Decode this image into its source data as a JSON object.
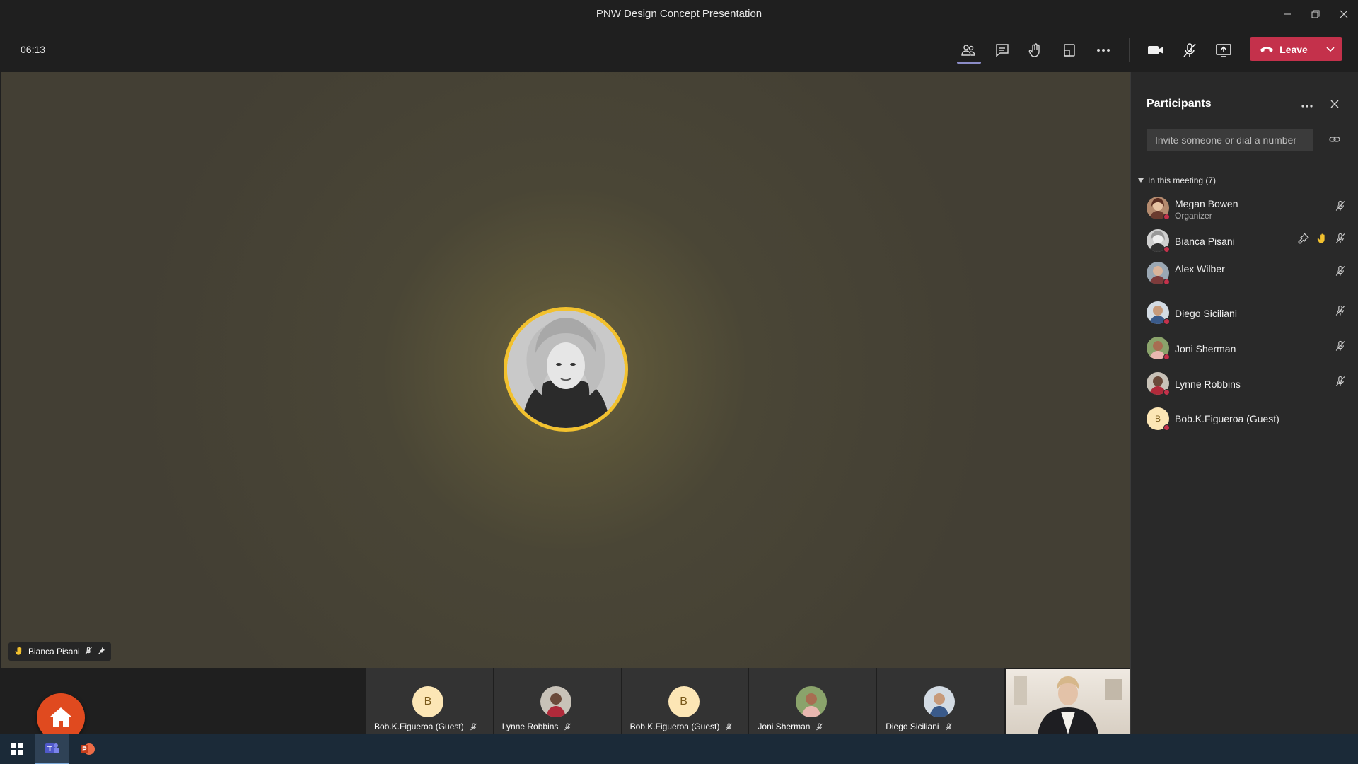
{
  "window": {
    "title": "PNW Design Concept Presentation"
  },
  "toolbar": {
    "timer": "06:13",
    "leave_label": "Leave",
    "icons": [
      "people-icon",
      "chat-icon",
      "raise-hand-icon",
      "share-tray-icon",
      "more-icon",
      "camera-icon",
      "mic-off-icon",
      "share-screen-icon"
    ]
  },
  "stage": {
    "active_speaker": "Bianca Pisani",
    "accent_color": "#f2c12e"
  },
  "strip": {
    "tiles": [
      {
        "name": "Bob.K.Figueroa (Guest)",
        "initial": "B"
      },
      {
        "name": "Lynne Robbins",
        "initial": ""
      },
      {
        "name": "Bob.K.Figueroa (Guest)",
        "initial": "B"
      },
      {
        "name": "Joni Sherman",
        "initial": ""
      },
      {
        "name": "Diego Siciliani",
        "initial": ""
      }
    ]
  },
  "panel": {
    "title": "Participants",
    "invite_placeholder": "Invite someone or dial a number",
    "section_label": "In this meeting (7)",
    "participants": [
      {
        "name": "Megan Bowen",
        "role": "Organizer"
      },
      {
        "name": "Bianca Pisani",
        "role": ""
      },
      {
        "name": "Alex Wilber",
        "role": ""
      },
      {
        "name": "Diego Siciliani",
        "role": ""
      },
      {
        "name": "Joni Sherman",
        "role": ""
      },
      {
        "name": "Lynne Robbins",
        "role": ""
      },
      {
        "name": "Bob.K.Figueroa (Guest)",
        "role": "",
        "initial": "B"
      }
    ]
  },
  "colors": {
    "leave": "#c4314b",
    "status_dot": "#c4314b",
    "home": "#e04a1f"
  }
}
